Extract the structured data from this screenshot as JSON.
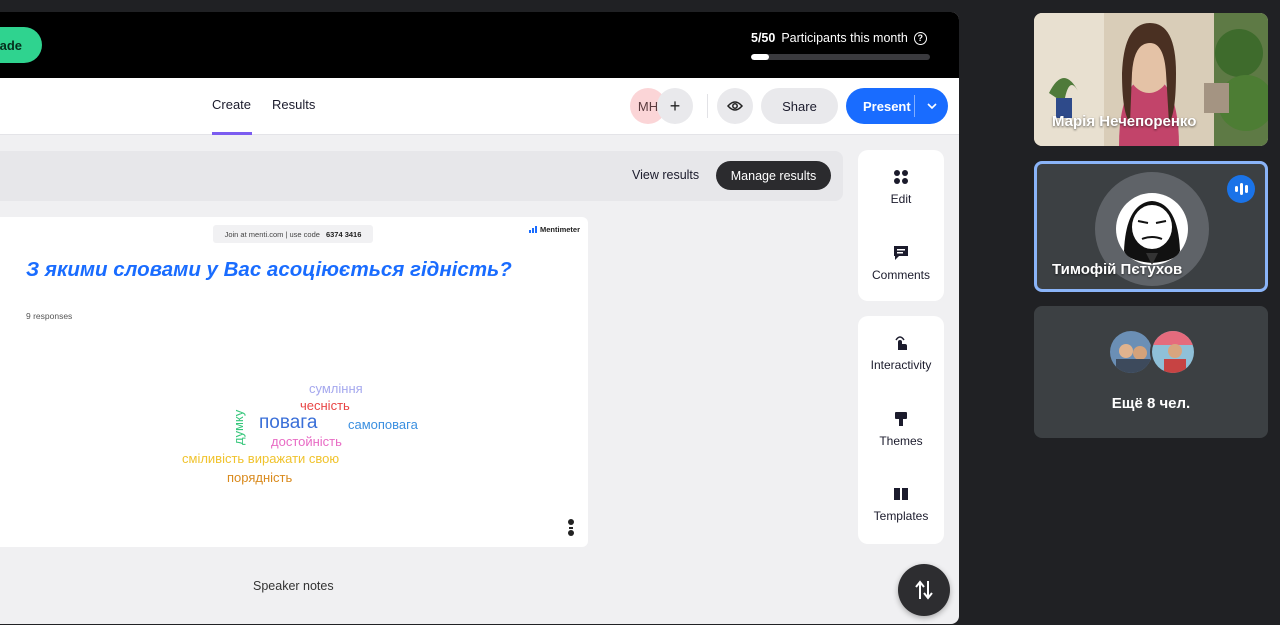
{
  "topbar": {
    "upgrade_label": "ade",
    "participants_count": "5/50",
    "participants_text": "Participants this month",
    "participants_progress": 0.1
  },
  "nav": {
    "tabs": [
      {
        "label": "Create"
      },
      {
        "label": "Results"
      }
    ],
    "collaborator_initials": "MH",
    "add_label": "+",
    "share_label": "Share",
    "present_label": "Present"
  },
  "results_bar": {
    "view_results": "View results",
    "manage_results": "Manage results"
  },
  "slide": {
    "join_text": "Join at menti.com | use code",
    "join_code": "6374 3416",
    "brand": "Mentimeter",
    "question": "З якими словами у Вас асоціюється гідність?",
    "responses": "9 responses",
    "words": [
      {
        "text": "сумління",
        "color": "#a5a8ee"
      },
      {
        "text": "чесність",
        "color": "#e84545"
      },
      {
        "text": "думку",
        "color": "#34c67a"
      },
      {
        "text": "повага",
        "color": "#3a6fd8"
      },
      {
        "text": "самоповага",
        "color": "#3a8fe0"
      },
      {
        "text": "достойність",
        "color": "#e86bc4"
      },
      {
        "text": "сміливість виражати свою",
        "color": "#f0c32d"
      },
      {
        "text": "порядність",
        "color": "#d98a1d"
      }
    ]
  },
  "speaker_notes": "Speaker notes",
  "side_panel": {
    "edit": "Edit",
    "comments": "Comments",
    "interactivity": "Interactivity",
    "themes": "Themes",
    "templates": "Templates"
  },
  "meet": {
    "tile1_name": "Марія Нечепоренко",
    "tile2_name": "Тимофій Пєтухов",
    "tile3_label": "Ещё 8 чел."
  },
  "colors": {
    "accent": "#196cff",
    "upgrade": "#2fd38f",
    "speaking_border": "#8ab4f8"
  }
}
